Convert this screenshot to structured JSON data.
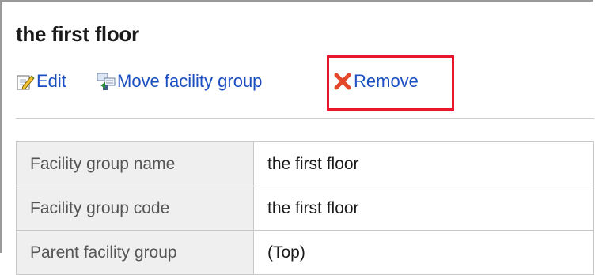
{
  "page": {
    "title": "the first floor"
  },
  "actions": {
    "edit": {
      "label": "Edit",
      "icon": "edit-icon"
    },
    "move": {
      "label": "Move facility group",
      "icon": "move-facility-group-icon"
    },
    "remove": {
      "label": "Remove",
      "icon": "remove-icon"
    }
  },
  "details": {
    "rows": [
      {
        "label": "Facility group name",
        "value": "the first floor"
      },
      {
        "label": "Facility group code",
        "value": "the first floor"
      },
      {
        "label": "Parent facility group",
        "value": "(Top)"
      }
    ]
  },
  "colors": {
    "link": "#1a4fc0",
    "highlight": "#e8172c",
    "header_cell": "#efefef"
  }
}
